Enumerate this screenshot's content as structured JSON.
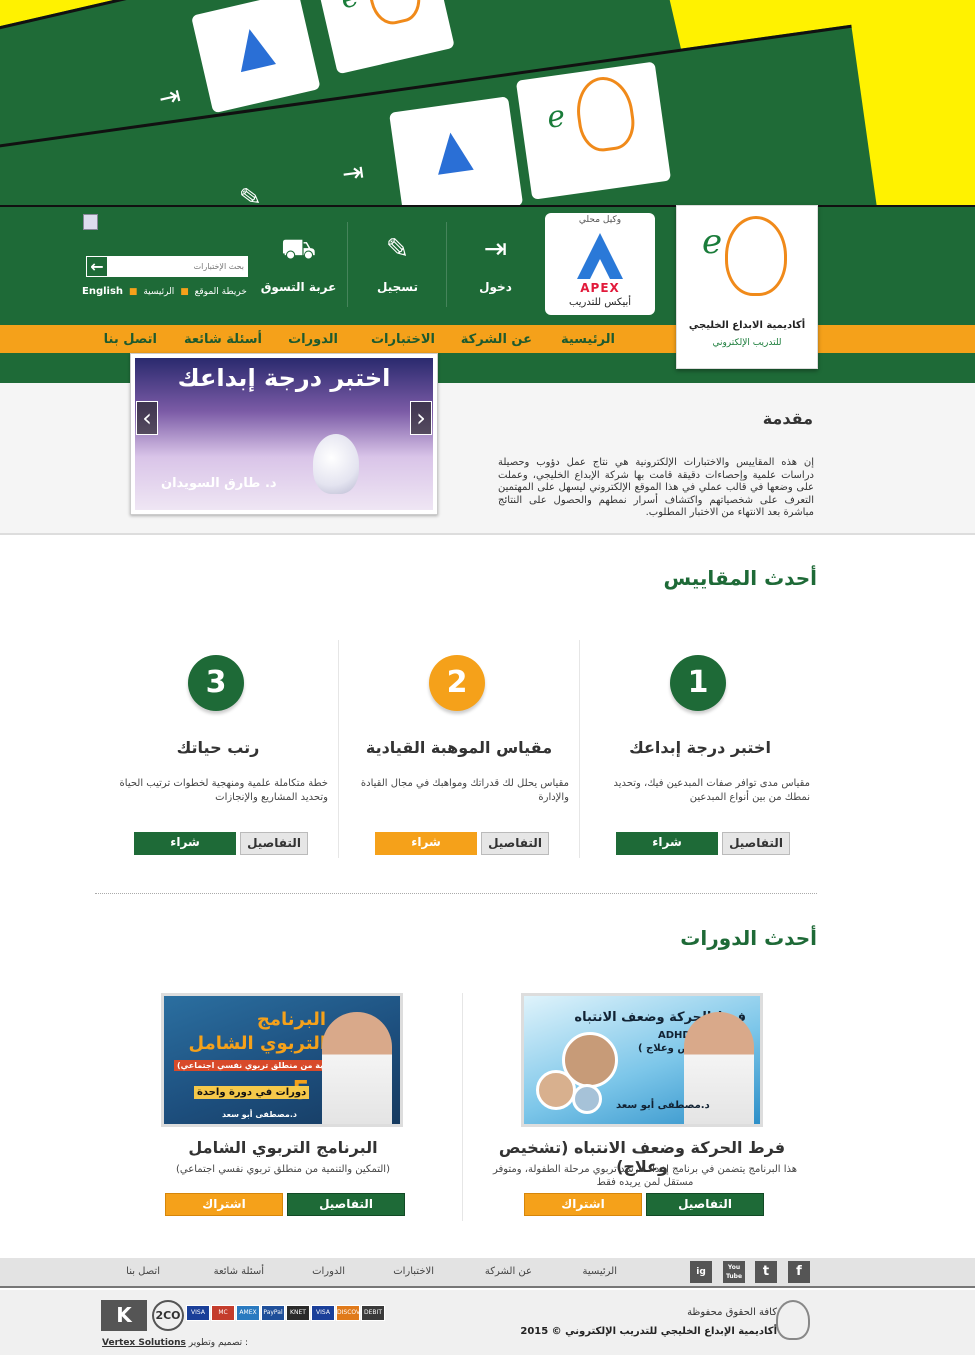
{
  "header": {
    "logo_name": "أكاديمية الابداع الخليجي",
    "logo_sub": "للتدريب الإلكتروني",
    "apex_local": "وكيل محلي",
    "apex_word": "APEX",
    "apex_caption": "أبيكس للتدريب",
    "nav_login": "دخول",
    "nav_register": "تسجيل",
    "nav_cart": "عربة التسوق",
    "search_placeholder": "بحث الإختبارات",
    "link_english": "English",
    "link_sitemap": "خريطة الموقع",
    "link_home": "الرئيسية"
  },
  "menu": {
    "home": "الرئيسية",
    "about": "عن الشركة",
    "tests": "الاختبارات",
    "courses": "الدورات",
    "faq": "أسئلة شائعة",
    "contact": "اتصل بنا"
  },
  "slider": {
    "title": "اختبر درجة إبداعك",
    "author": "د. طارق السويدان"
  },
  "intro": {
    "title": "مقدمة",
    "text": "إن هذه المقاييس والاختبارات الإلكترونية هي نتاج عمل دؤوب وحصيلة دراسات علمية وإحصاءات دقيقة قامت بها شركة الإبداع الخليجي، وعملت على وضعها في قالب عملي في هذا الموقع الإلكتروني ليسهل على المهتمين التعرف على شخصياتهم واكتشاف أسرار نمطهم والحصول على النتائج مباشرة بعد الانتهاء من الاختبار المطلوب."
  },
  "measures": {
    "section_title": "أحدث المقاييس",
    "details_label": "التفاصيل",
    "buy_label": "شراء",
    "items": [
      {
        "number": "1",
        "title": "اختبر درجة إبداعك",
        "desc": "مقياس مدى توافر صفات المبدعين فيك، وتحديد نمطك من بين أنواع المبدعين",
        "color": "#1e6a37"
      },
      {
        "number": "2",
        "title": "مقياس الموهبة القيادية",
        "desc": "مقياس يحلل لك قدراتك ومواهبك في مجال القيادة والإدارة",
        "color": "#f5a11a"
      },
      {
        "number": "3",
        "title": "رتب حياتك",
        "desc": "خطة متكاملة علمية ومنهجية لخطوات ترتيب الحياة وتحديد المشاريع والإنجازات",
        "color": "#1e6a37"
      }
    ]
  },
  "courses": {
    "section_title": "أحدث الدورات",
    "details_label": "التفاصيل",
    "subscribe_label": "اشتراك",
    "items": [
      {
        "title": "فرط الحركة وضعف الانتباه (تشخيص وعلاج)",
        "desc": "هذا البرنامج يتضمن في برنامج إعداد مرشد تربوي مرحلة الطفولة، ومتوفر مستقل لمن يريده فقط",
        "img_title": "فرط الحركة وضعف الانتباه",
        "img_adhd": "ADHD",
        "img_sub": "( تشخيص وعلاج )",
        "img_author": "د.مصطفى أبو سعد"
      },
      {
        "title": "البرنامج التربوي الشامل",
        "desc": "(التمكين والتنمية من منطلق تربوي نفسي اجتماعي)",
        "img_title": "البرنامج التربوي الشامل",
        "img_sub": "(التمكين والتنمية من منطلق تربوي نفسي اجتماعي)",
        "img_count": "5",
        "img_count_text": "دورات في دورة واحدة",
        "img_author": "د.مصطفى أبو سعد"
      }
    ]
  },
  "footer": {
    "links": [
      "الرئيسية",
      "عن الشركة",
      "الاختبارات",
      "الدورات",
      "أسئلة شائعة",
      "اتصل بنا"
    ],
    "social": [
      "f",
      "t",
      "You Tube",
      "ig"
    ],
    "copyright": "كافة الحقوق محفوظة",
    "academy": "أكاديمية الإبداع الخليجي للتدريب الإلكتروني © 2015",
    "payments": [
      "VISA",
      "MC",
      "AMEX",
      "PayPal",
      "KNET",
      "VISA",
      "DISCOVER",
      "DEBIT"
    ],
    "twoco": "2CO",
    "credit_label": "تصميم وتطوير :",
    "credit_company": "Vertex Solutions"
  }
}
